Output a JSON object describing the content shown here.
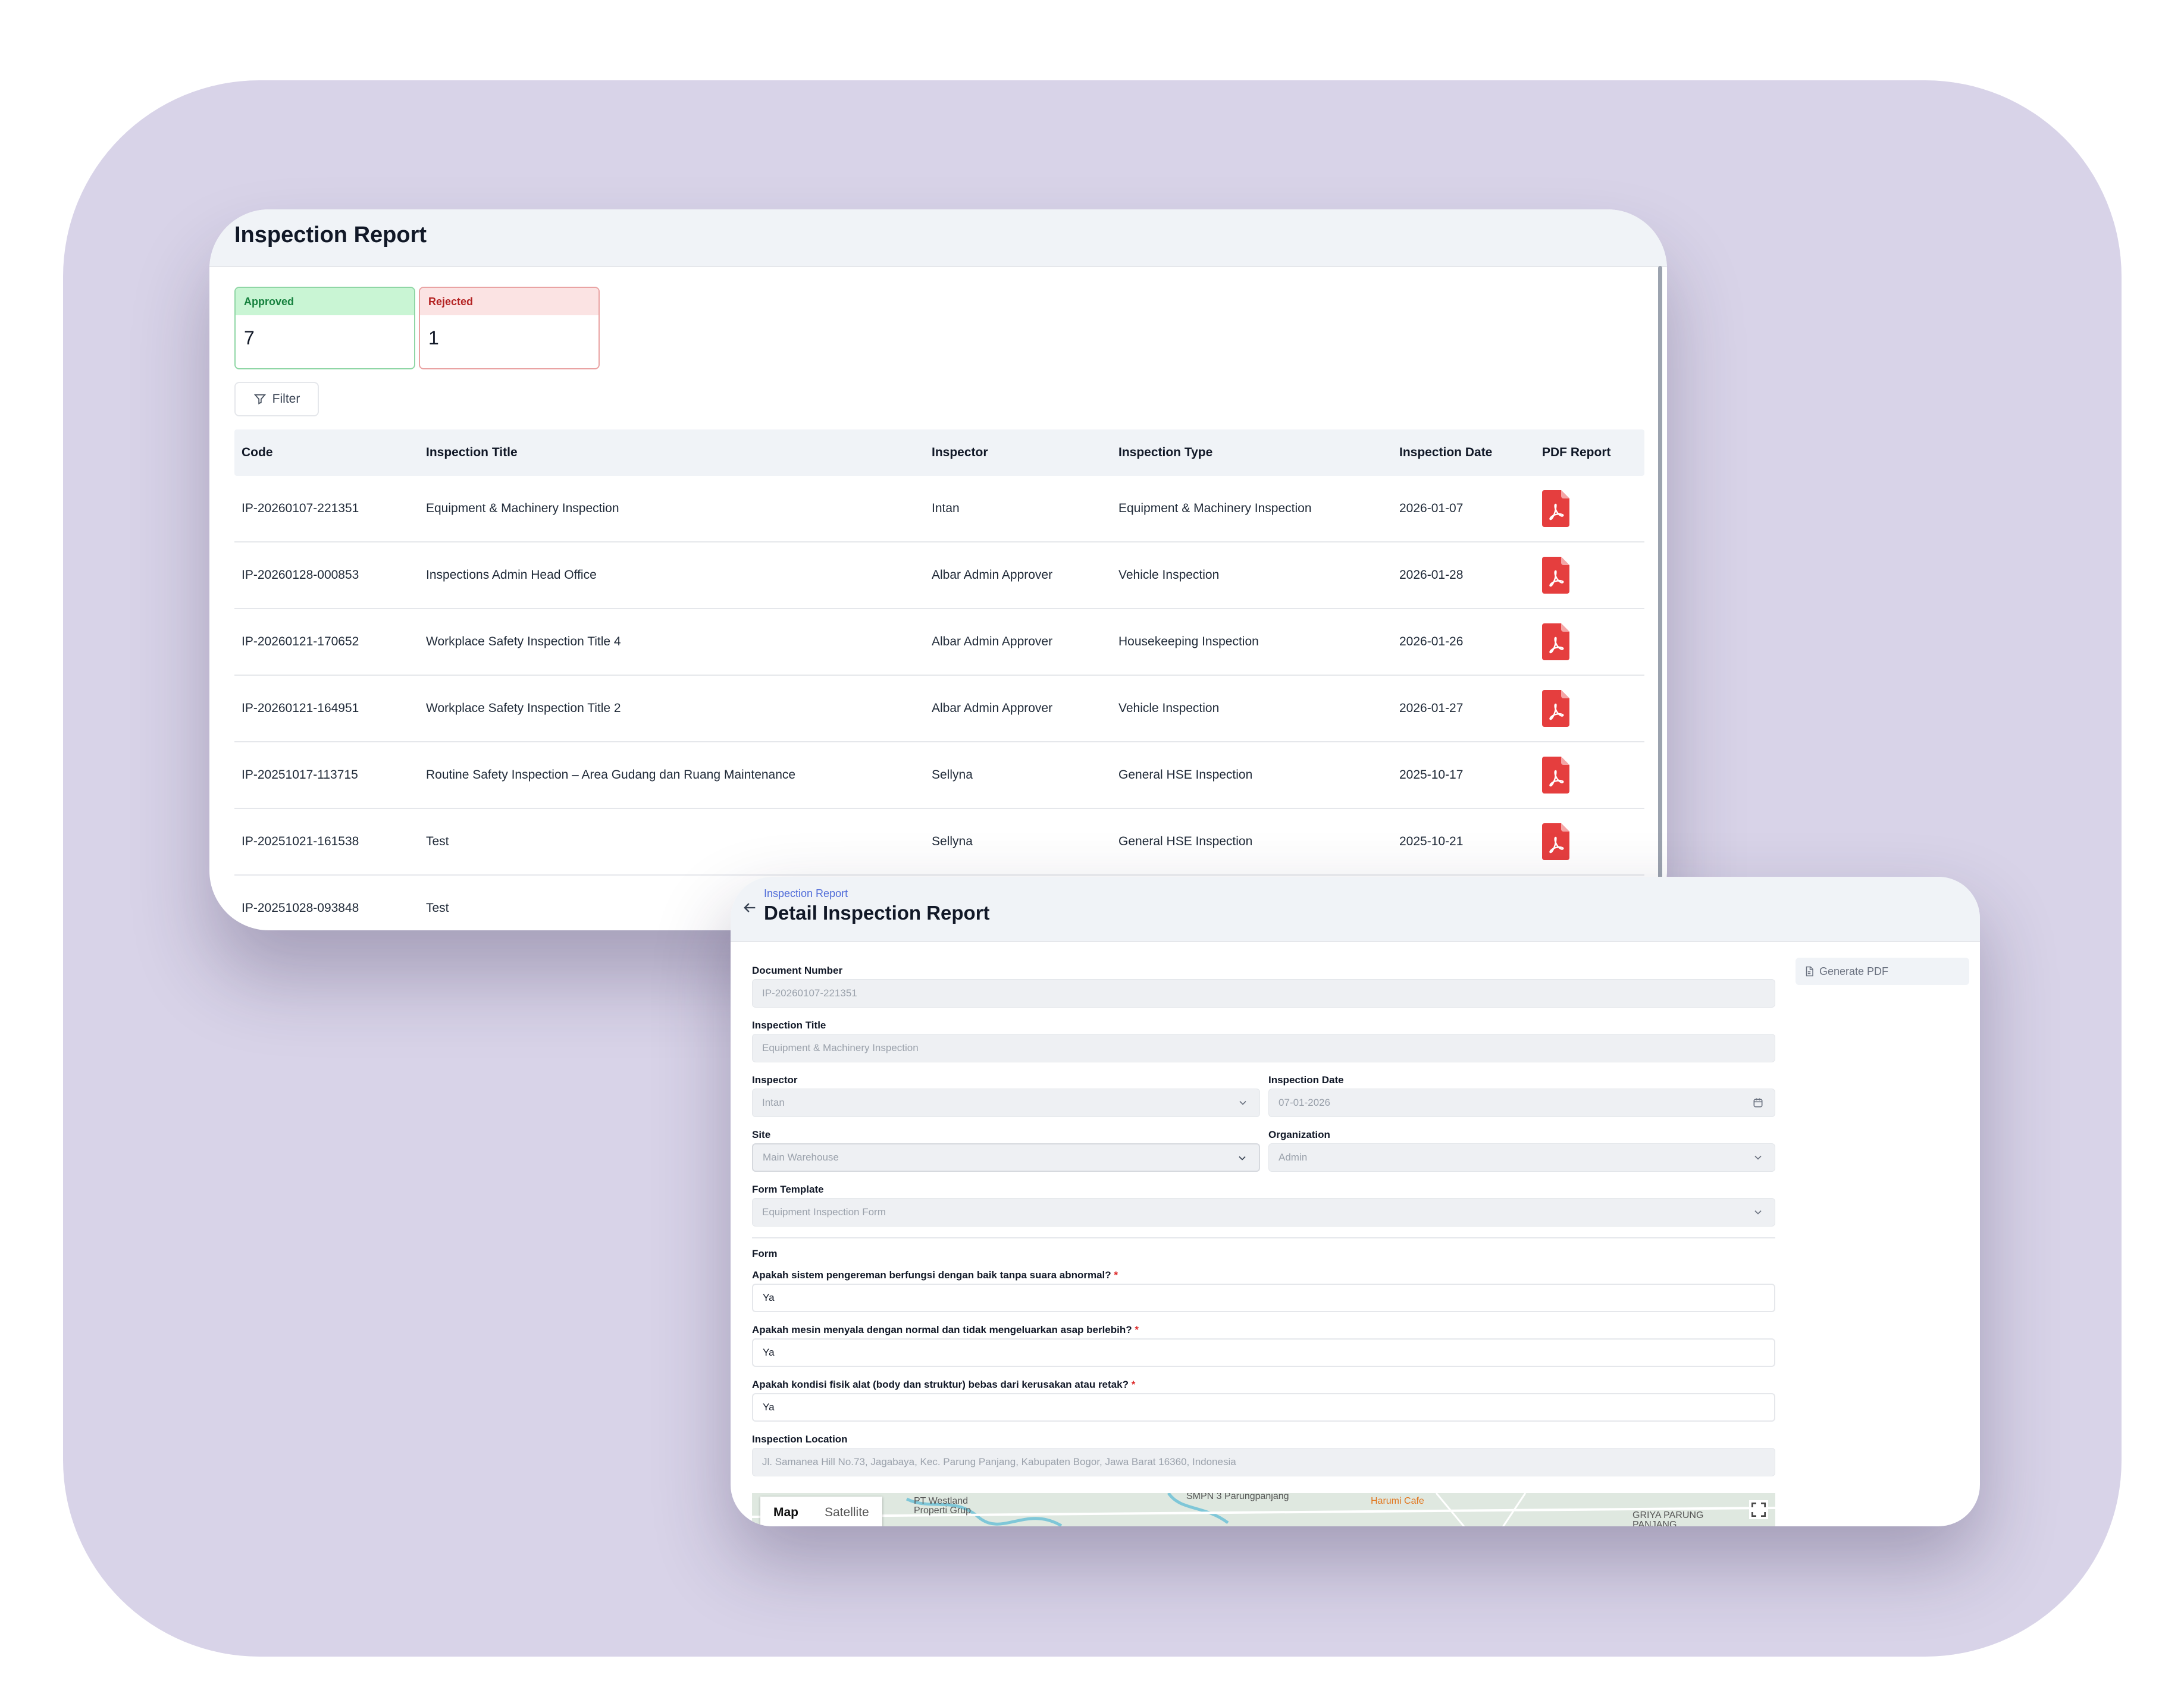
{
  "report": {
    "title": "Inspection Report",
    "stats": {
      "approved_label": "Approved",
      "approved_value": "7",
      "rejected_label": "Rejected",
      "rejected_value": "1"
    },
    "filter_label": "Filter",
    "columns": [
      "Code",
      "Inspection Title",
      "Inspector",
      "Inspection Type",
      "Inspection Date",
      "PDF Report"
    ],
    "rows": [
      [
        "IP-20260107-221351",
        "Equipment & Machinery Inspection",
        "Intan",
        "Equipment & Machinery Inspection",
        "2026-01-07"
      ],
      [
        "IP-20260128-000853",
        "Inspections Admin Head Office",
        "Albar Admin Approver",
        "Vehicle Inspection",
        "2026-01-28"
      ],
      [
        "IP-20260121-170652",
        "Workplace Safety Inspection Title 4",
        "Albar Admin Approver",
        "Housekeeping Inspection",
        "2026-01-26"
      ],
      [
        "IP-20260121-164951",
        "Workplace Safety Inspection Title 2",
        "Albar Admin Approver",
        "Vehicle Inspection",
        "2026-01-27"
      ],
      [
        "IP-20251017-113715",
        "Routine Safety Inspection – Area Gudang dan Ruang Maintenance",
        "Sellyna",
        "General HSE Inspection",
        "2025-10-17"
      ],
      [
        "IP-20251021-161538",
        "Test",
        "Sellyna",
        "General HSE Inspection",
        "2025-10-21"
      ],
      [
        "IP-20251028-093848",
        "Test",
        "",
        "",
        ""
      ]
    ],
    "pdf_icon": "pdf-file-icon",
    "pdf_color": "#e53e3e"
  },
  "detail": {
    "breadcrumb": "Inspection Report",
    "title": "Detail Inspection Report",
    "generate_pdf": "Generate PDF",
    "fields": {
      "document_number_label": "Document Number",
      "document_number": "IP-20260107-221351",
      "inspection_title_label": "Inspection Title",
      "inspection_title": "Equipment & Machinery Inspection",
      "inspector_label": "Inspector",
      "inspector": "Intan",
      "inspection_date_label": "Inspection Date",
      "inspection_date": "07-01-2026",
      "site_label": "Site",
      "site": "Main Warehouse",
      "organization_label": "Organization",
      "organization": "Admin",
      "form_template_label": "Form Template",
      "form_template": "Equipment Inspection Form"
    },
    "form_section": "Form",
    "questions": [
      {
        "label": "Apakah sistem pengereman berfungsi dengan baik tanpa suara abnormal?",
        "answer": "Ya"
      },
      {
        "label": "Apakah mesin menyala dengan normal dan tidak mengeluarkan asap berlebih?",
        "answer": "Ya"
      },
      {
        "label": "Apakah kondisi fisik alat (body dan struktur) bebas dari kerusakan atau retak?",
        "answer": "Ya"
      }
    ],
    "required_mark": "*",
    "location_label": "Inspection Location",
    "location": "Jl. Samanea Hill No.73, Jagabaya, Kec. Parung Panjang, Kabupaten Bogor, Jawa Barat 16360, Indonesia",
    "map": {
      "tab_map": "Map",
      "tab_satellite": "Satellite",
      "place_1_line1": "PT Westland",
      "place_1_line2": "Properti Grup",
      "place_2": "SMPN 3 Parungpanjang",
      "place_3": "Harumi Cafe",
      "place_4_line1": "GRIYA PARUNG",
      "place_4_line2": "PANJANG"
    }
  },
  "colors": {
    "backdrop": "#d8d3e8",
    "approved": "#15803d",
    "rejected": "#b42323",
    "accent_link": "#4f6bd8"
  }
}
